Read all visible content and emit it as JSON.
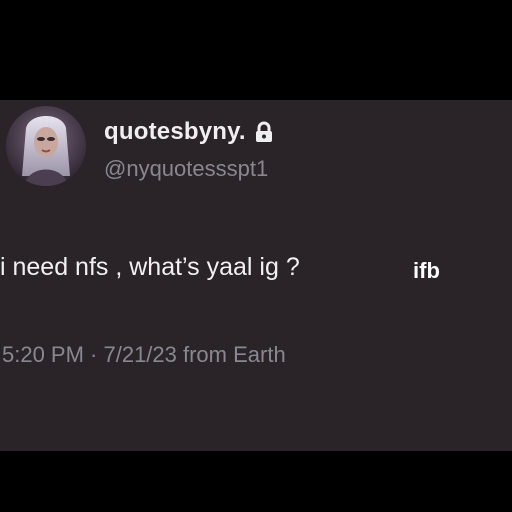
{
  "colors": {
    "outer_background": "#000000",
    "card_background": "#2a2428",
    "primary_text": "#f2f0f2",
    "secondary_text": "#8a8790"
  },
  "tweet": {
    "avatar_icon": "avatar-image",
    "display_name": "quotesbyny.",
    "lock_icon": "lock-icon",
    "handle": "@nyquotessspt1",
    "text": "i need nfs , what’s yaal ig ?",
    "overlay_tag": "ifb",
    "timestamp_line": "5:20 PM · 7/21/23 from Earth"
  }
}
